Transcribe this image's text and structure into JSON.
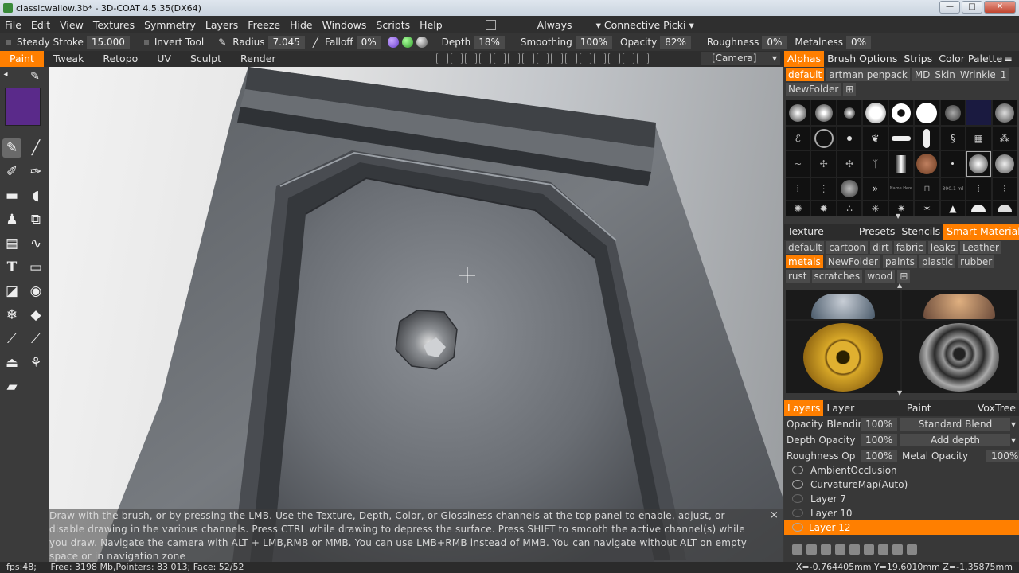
{
  "window": {
    "title": "classicwallow.3b* - 3D-COAT 4.5.35(DX64)",
    "buttons": [
      "—",
      "□",
      "✕"
    ]
  },
  "menu": {
    "items": [
      "File",
      "Edit",
      "View",
      "Textures",
      "Symmetry",
      "Layers",
      "Freeze",
      "Hide",
      "Windows",
      "Scripts",
      "Help"
    ],
    "always_label": "Always",
    "connective_label": "Connective Picki"
  },
  "tool_options": {
    "steady": "Steady Stroke",
    "steady_value": "15.000",
    "invert": "Invert Tool",
    "radius": "Radius",
    "radius_value": "7.045",
    "falloff": "Falloff",
    "falloff_value": "0%",
    "depth": "Depth",
    "depth_value": "18%",
    "smoothing": "Smoothing",
    "smoothing_value": "100%",
    "opacity": "Opacity",
    "opacity_value": "82%",
    "roughness": "Roughness",
    "roughness_value": "0%",
    "metalness": "Metalness",
    "metalness_value": "0%"
  },
  "room_tabs": [
    "Paint",
    "Tweak",
    "Retopo",
    "UV",
    "Sculpt",
    "Render"
  ],
  "camera_label": "[Camera]",
  "left_toolbar": {
    "current_color": "#5a2a8a",
    "tools": [
      "brush-tool",
      "pencil-tool",
      "airbrush-tool",
      "pen-tool",
      "line-tool",
      "fill-tool",
      "stamp-tool",
      "cube-tool",
      "paper-tool",
      "curve-tool",
      "text-tool",
      "page-tool",
      "eraser-tool",
      "eye-tool",
      "snowflake-tool",
      "paint-bucket-tool",
      "pipette-tool",
      "brush-alt-tool",
      "iron-tool",
      "butterfly-tool",
      "ruler-tool"
    ]
  },
  "hint": {
    "text": "Draw with the brush, or by pressing the LMB. Use the Texture, Depth, Color, or Glossiness channels at the top panel to enable, adjust, or disable drawing in the various channels. Press CTRL while drawing to depress the surface. Press SHIFT to smooth the active channel(s) while you draw. Navigate the camera with ALT + LMB,RMB or MMB. You can use LMB+RMB instead of MMB. You can navigate without ALT on empty space or in navigation zone",
    "close": "×"
  },
  "status": {
    "left": "fps:48;     Free: 3198 Mb,Pointers: 83 013; Face: 52/52",
    "coords": "X=-0.764405mm  Y=19.6010mm  Z=-1.35875mm"
  },
  "alphas_panel": {
    "tabs": [
      "Alphas",
      "Brush Options",
      "Strips",
      "Color Palette"
    ],
    "folders": [
      "default",
      "artman penpack",
      "MD_Skin_Wrinkle_1"
    ],
    "new_folder": "NewFolder",
    "thumb_text": [
      "Name Here",
      "390.1 ml"
    ]
  },
  "materials_panel": {
    "tabs": [
      "Texture Editor",
      "Presets",
      "Stencils",
      "Smart Materials"
    ],
    "categories": [
      "default",
      "cartoon",
      "dirt",
      "fabric",
      "leaks",
      "Leather",
      "metals",
      "NewFolder",
      "paints",
      "plastic",
      "rubber",
      "rust",
      "scratches",
      "wood"
    ]
  },
  "layers_panel": {
    "tabs": [
      "Layers",
      "Layer Blending",
      "Paint Objects",
      "VoxTree"
    ],
    "opacity_label": "Opacity",
    "opacity_value": "100%",
    "blend_mode": "Standard Blend",
    "depth_opacity_label": "Depth Opacity",
    "depth_opacity_value": "100%",
    "depth_mode": "Add depth",
    "roughness_label": "Roughness Op",
    "roughness_value": "100%",
    "metal_label": "Metal Opacity",
    "metal_value": "100%",
    "layers": [
      "AmbientOcclusion",
      "CurvatureMap(Auto)",
      "Layer 7",
      "Layer 10",
      "Layer 12"
    ]
  }
}
